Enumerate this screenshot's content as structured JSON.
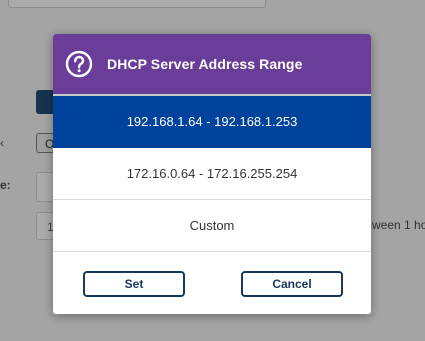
{
  "background": {
    "select_value": "O",
    "label_1": "‹",
    "label_2": "e:",
    "input_2_value": "1",
    "suffix_text": "ween 1 ho"
  },
  "dialog": {
    "title": "DHCP Server Address Range",
    "icon": "question-circle-icon",
    "options": [
      {
        "label": "192.168.1.64 - 192.168.1.253",
        "selected": true
      },
      {
        "label": "172.16.0.64 - 172.16.255.254",
        "selected": false
      },
      {
        "label": "Custom",
        "selected": false
      }
    ],
    "set_label": "Set",
    "cancel_label": "Cancel"
  },
  "colors": {
    "header": "#6a3e98",
    "selected": "#00439c",
    "button_border": "#17375e"
  }
}
